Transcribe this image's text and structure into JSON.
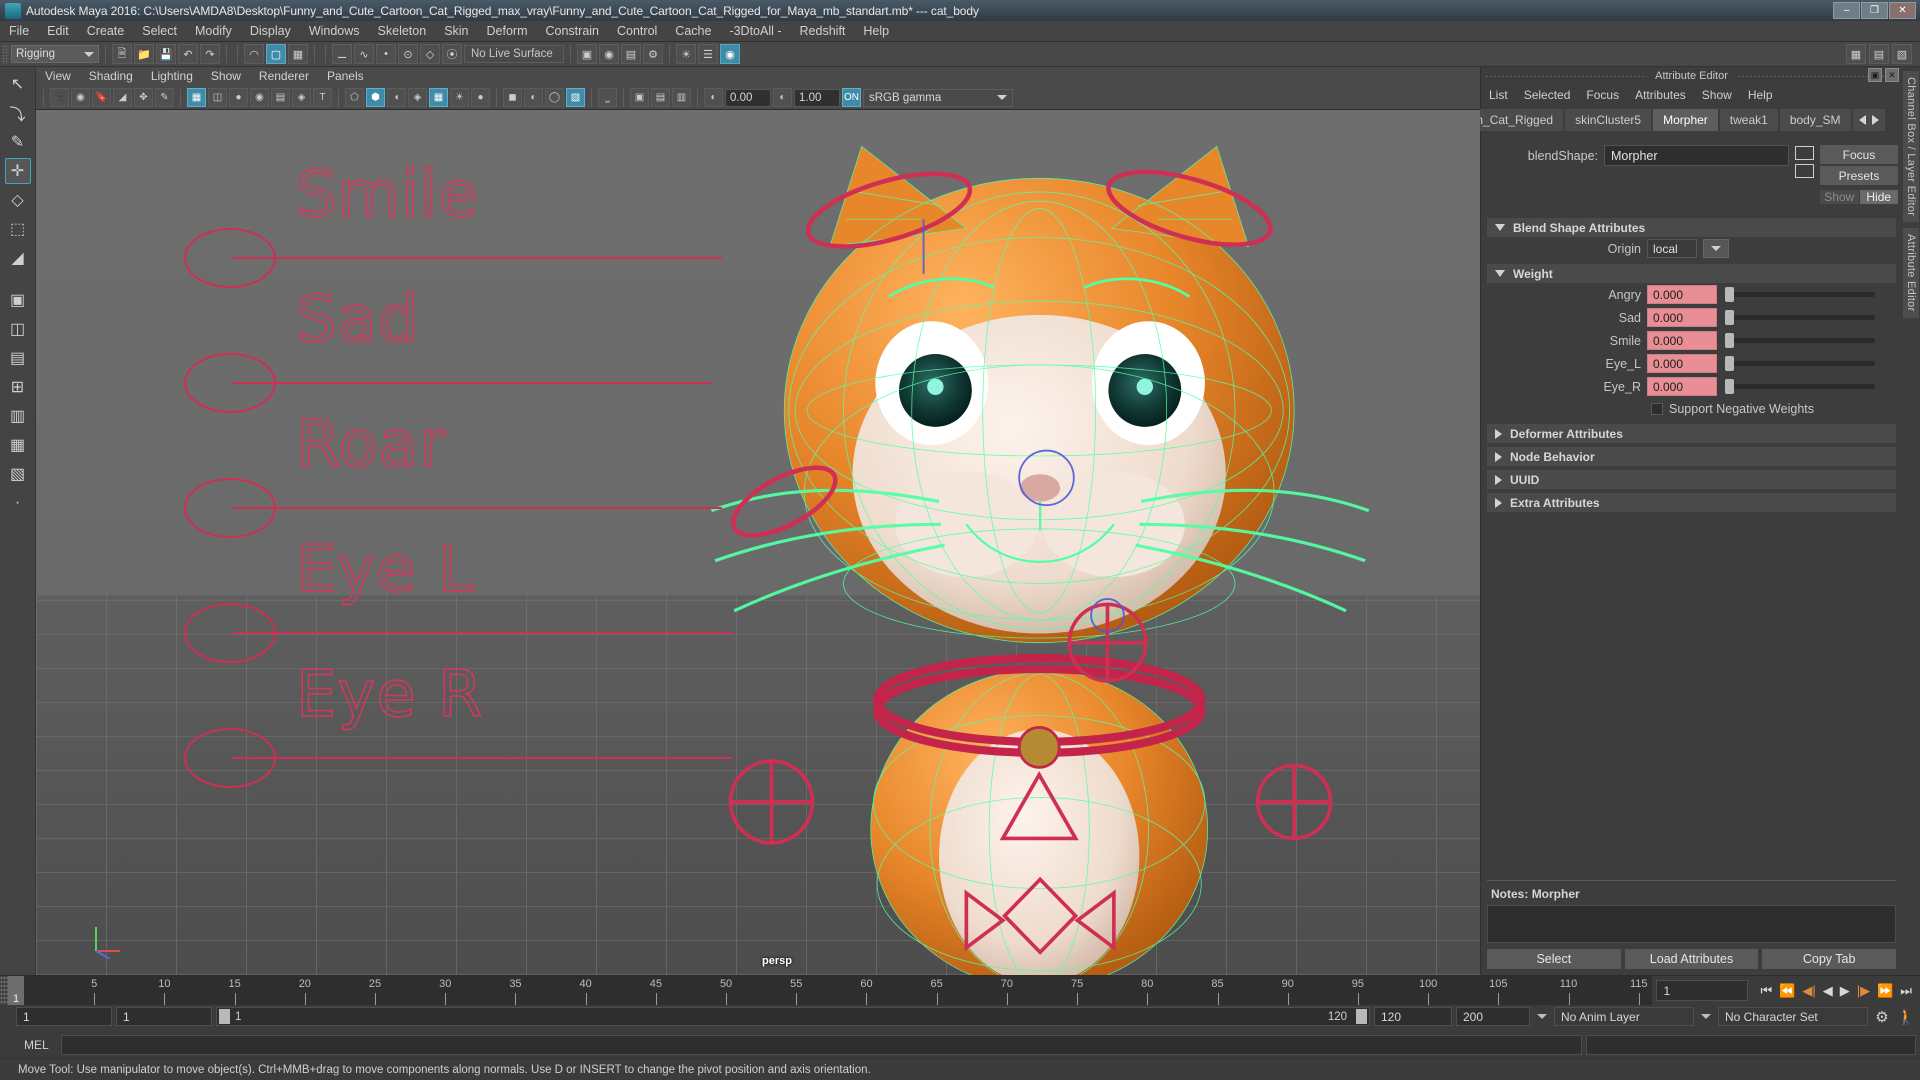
{
  "window": {
    "title": "Autodesk Maya 2016: C:\\Users\\AMDA8\\Desktop\\Funny_and_Cute_Cartoon_Cat_Rigged_max_vray\\Funny_and_Cute_Cartoon_Cat_Rigged_for_Maya_mb_standart.mb*  ---  cat_body",
    "minimize": "–",
    "maximize": "❐",
    "close": "✕"
  },
  "menubar": [
    "File",
    "Edit",
    "Create",
    "Select",
    "Modify",
    "Display",
    "Windows",
    "Skeleton",
    "Skin",
    "Deform",
    "Constrain",
    "Control",
    "Cache",
    "-3DtoAll -",
    "Redshift",
    "Help"
  ],
  "toolbar": {
    "menuset": "Rigging",
    "live_surface": "No Live Surface",
    "icons": [
      "new-scene-icon",
      "open-scene-icon",
      "save-scene-icon",
      "undo-icon",
      "redo-icon",
      "select-by-hierarchy-icon",
      "select-by-object-icon",
      "select-by-component-icon",
      "snap-grid-icon",
      "snap-curve-icon",
      "snap-point-icon",
      "snap-projected-icon",
      "snap-view-plane-icon",
      "make-live-icon",
      "render-view-icon",
      "render-current-frame-icon",
      "ipr-render-icon",
      "render-settings-icon",
      "hypershade-icon",
      "outliner-icon",
      "node-editor-icon"
    ]
  },
  "viewport": {
    "menus": [
      "View",
      "Shading",
      "Lighting",
      "Show",
      "Renderer",
      "Panels"
    ],
    "camera_label": "persp",
    "exposure": "0.00",
    "gamma": "1.00",
    "view_transform": "sRGB gamma",
    "color_mgmt_toggle": "ON",
    "toolbar_icons": [
      "select-camera-icon",
      "camera-attributes-icon",
      "bookmark-icon",
      "image-plane-icon",
      "two-d-pan-zoom-icon",
      "grease-pencil-icon",
      "grid-icon",
      "film-gate-icon",
      "resolution-gate-icon",
      "gate-mask-icon",
      "xray-icon",
      "xray-joints-icon",
      "texture-icon",
      "wireframe-icon",
      "smooth-shade-icon",
      "flat-shade-icon",
      "wireframe-on-shaded-icon",
      "textured-icon",
      "use-default-lights-icon",
      "shadows-icon",
      "screen-space-ao-icon",
      "motion-blur-icon",
      "multisample-icon",
      "isolate-select-icon",
      "xray-active-icon",
      "panel-layout-icon"
    ],
    "control_labels": [
      "Smile",
      "Sad",
      "Roar",
      "Eye L",
      "Eye R"
    ]
  },
  "left_tools": [
    {
      "name": "select-tool",
      "glyph": "↖",
      "selected": false
    },
    {
      "name": "lasso-tool",
      "glyph": "⤵",
      "selected": false
    },
    {
      "name": "paint-select-tool",
      "glyph": "✎",
      "selected": false
    },
    {
      "name": "move-tool",
      "glyph": "✛",
      "selected": true
    },
    {
      "name": "rotate-tool",
      "glyph": "◇",
      "selected": false
    },
    {
      "name": "scale-tool",
      "glyph": "⬚",
      "selected": false
    },
    {
      "name": "last-tool",
      "glyph": "◢",
      "selected": false
    },
    {
      "name": "single-pane-layout",
      "glyph": "▣",
      "selected": false
    },
    {
      "name": "two-pane-layout",
      "glyph": "◫",
      "selected": false
    },
    {
      "name": "three-pane-layout",
      "glyph": "▤",
      "selected": false
    },
    {
      "name": "four-pane-layout",
      "glyph": "⊞",
      "selected": false
    },
    {
      "name": "outliner-persp-layout",
      "glyph": "▥",
      "selected": false
    },
    {
      "name": "persp-graph-layout",
      "glyph": "▦",
      "selected": false
    },
    {
      "name": "hypershade-persp-layout",
      "glyph": "▧",
      "selected": false
    },
    {
      "name": "more-layouts",
      "glyph": "·",
      "selected": false
    }
  ],
  "attribute_editor": {
    "panel_title": "Attribute Editor",
    "menu": [
      "List",
      "Selected",
      "Focus",
      "Attributes",
      "Show",
      "Help"
    ],
    "tabs": [
      {
        "label": "oon_Cat_Rigged",
        "active": false
      },
      {
        "label": "skinCluster5",
        "active": false
      },
      {
        "label": "Morpher",
        "active": true
      },
      {
        "label": "tweak1",
        "active": false
      },
      {
        "label": "body_SM",
        "active": false
      }
    ],
    "node_type_label": "blendShape:",
    "node_name": "Morpher",
    "buttons": {
      "focus": "Focus",
      "presets": "Presets",
      "show": "Show",
      "hide": "Hide"
    },
    "sections": {
      "blend_shape_attributes": "Blend Shape Attributes",
      "origin_label": "Origin",
      "origin_value": "local",
      "weight": "Weight",
      "support_negative_weights": "Support Negative Weights",
      "collapsed": [
        "Deformer Attributes",
        "Node Behavior",
        "UUID",
        "Extra Attributes"
      ]
    },
    "weights": [
      {
        "label": "Angry",
        "value": "0.000"
      },
      {
        "label": "Sad",
        "value": "0.000"
      },
      {
        "label": "Smile",
        "value": "0.000"
      },
      {
        "label": "Eye_L",
        "value": "0.000"
      },
      {
        "label": "Eye_R",
        "value": "0.000"
      }
    ],
    "notes_label": "Notes:",
    "notes_value": "Morpher",
    "footer": [
      "Select",
      "Load Attributes",
      "Copy Tab"
    ],
    "side_tabs": [
      "Channel Box / Layer Editor",
      "Attribute Editor"
    ]
  },
  "timeline": {
    "ticks": [
      "5",
      "10",
      "15",
      "20",
      "25",
      "30",
      "35",
      "40",
      "45",
      "50",
      "55",
      "60",
      "65",
      "70",
      "75",
      "80",
      "85",
      "90",
      "95",
      "100",
      "105",
      "110",
      "115",
      "120"
    ],
    "current_frame": "1",
    "current_frame_field": "1",
    "playback_buttons": [
      "go-to-start-icon",
      "step-back-keyframe-icon",
      "step-back-frame-icon",
      "play-backwards-icon",
      "play-forwards-icon",
      "step-forward-frame-icon",
      "step-forward-keyframe-icon",
      "go-to-end-icon"
    ],
    "range_start": "1",
    "range_start2": "1",
    "slider_start": "1",
    "slider_end": "120",
    "range_end": "120",
    "playback_end": "200",
    "anim_layer": "No Anim Layer",
    "character_set": "No Character Set",
    "anim_prefs_icon": "animation-preferences-icon",
    "character_icon": "character-set-icon"
  },
  "command_line": {
    "language": "MEL",
    "input_value": "",
    "help_text": "Move Tool: Use manipulator to move object(s). Ctrl+MMB+drag to move components along normals. Use D or INSERT to change the pivot position and axis orientation."
  },
  "colors": {
    "accent_blue": "#3f8ba8",
    "weight_field": "#e98e95",
    "control_curve_red": "#cf2f52",
    "panel_bg": "#3d3d3d"
  }
}
